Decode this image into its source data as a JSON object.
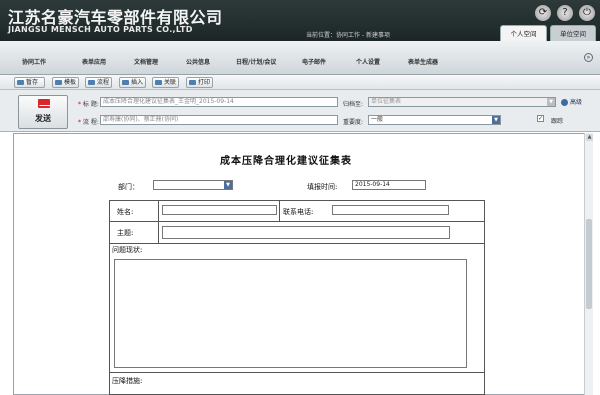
{
  "header": {
    "company_cn": "江苏名豪汽车零部件有限公司",
    "company_en": "JIANGSU MENSCH AUTO PARTS CO.,LTD",
    "location": "当前位置：协同工作 - 新建事项",
    "tabs": [
      "个人空间",
      "单位空间"
    ]
  },
  "nav": [
    "协同工作",
    "表单应用",
    "文档管理",
    "公共信息",
    "日程/计划/会议",
    "电子邮件",
    "个人设置",
    "表单生成器"
  ],
  "toolbar": [
    "暂存",
    "模板",
    "流程",
    "插入",
    "关联",
    "打印"
  ],
  "form": {
    "send_label": "发送",
    "title_label": "标  题:",
    "title_value": "成本压降合理化建议征集表_王金明_2015-09-14",
    "flow_label": "流  程:",
    "flow_value": "邵寿康(协同)、蔡正鼎(协同)",
    "archive_label": "归档至:",
    "archive_value": "单位征集表",
    "importance_label": "重要度:",
    "importance_value": "一般",
    "advanced_label": "高级",
    "trace_label": "跟踪"
  },
  "doc": {
    "title": "成本压降合理化建议征集表",
    "dept_label": "部门：",
    "date_label": "填报时间:",
    "date_value": "2015-09-14",
    "name_label": "姓名:",
    "phone_label": "联系电话:",
    "subject_label": "主题:",
    "issue_label": "问题现状:",
    "measure_label": "压降措施:"
  }
}
